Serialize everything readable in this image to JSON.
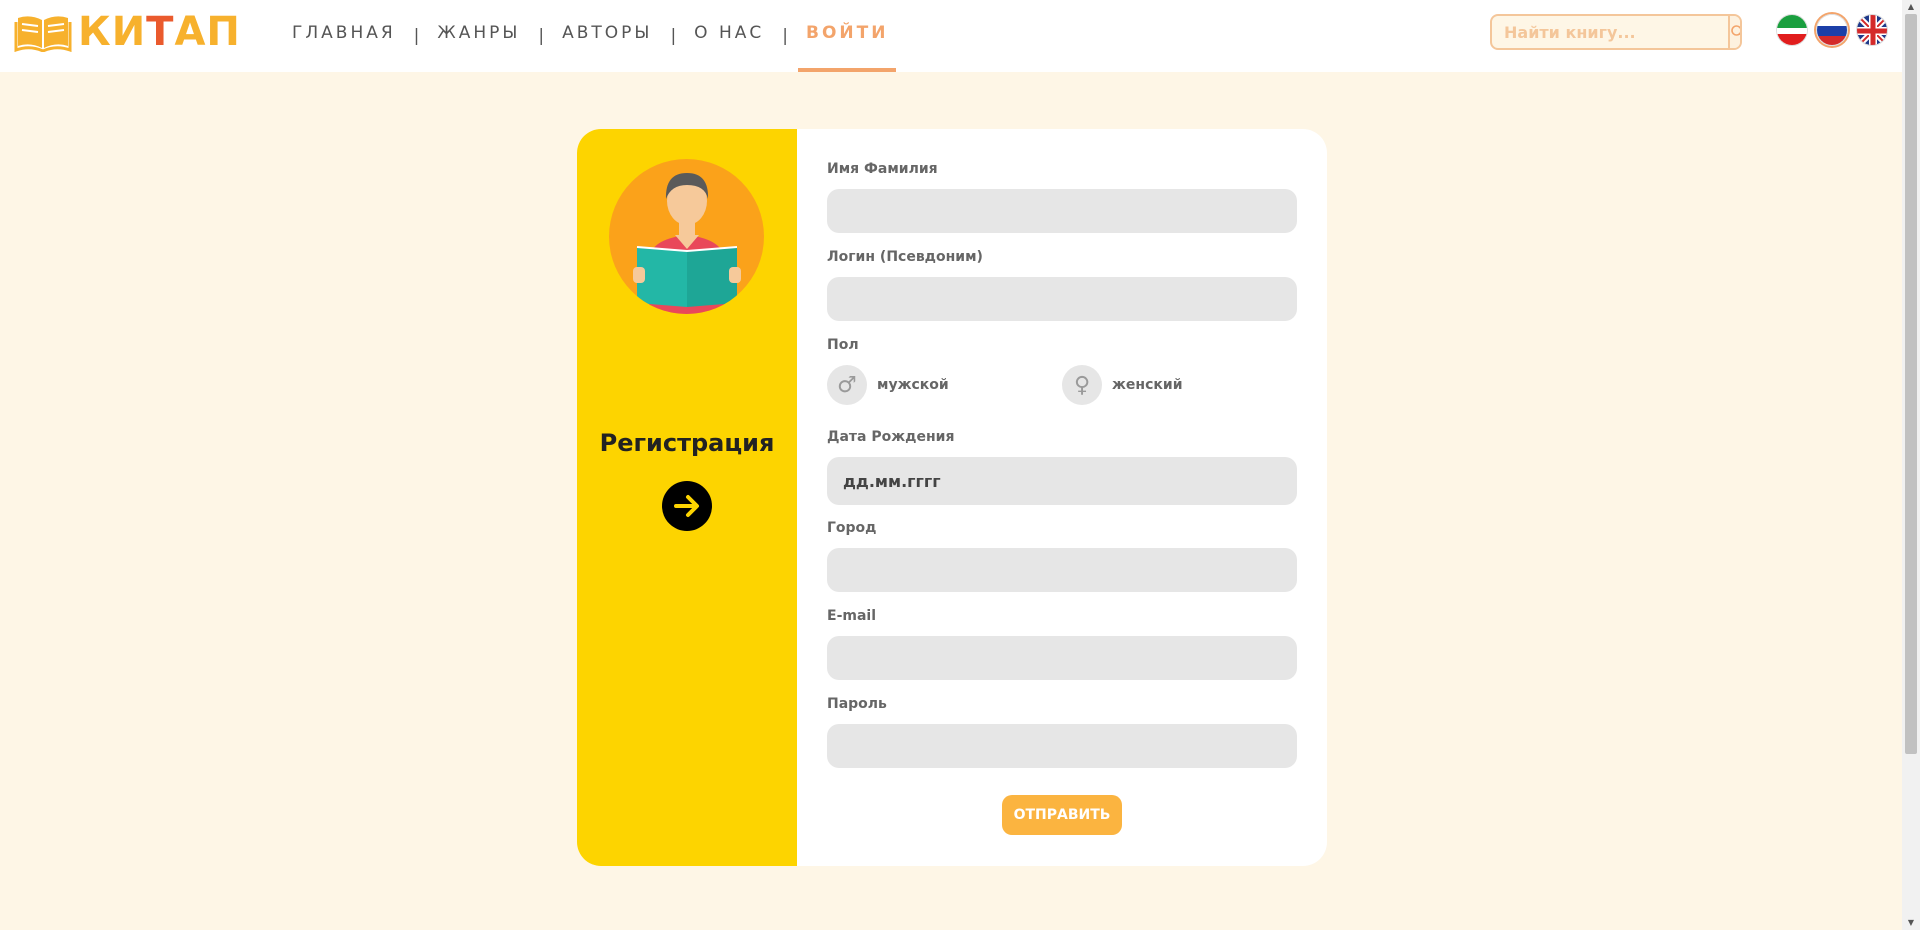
{
  "brand": {
    "logo_text_part1": "КИ",
    "logo_text_part2": "Т",
    "logo_text_part3": "АП"
  },
  "nav": {
    "items": [
      {
        "label": "ГЛАВНАЯ"
      },
      {
        "label": "ЖАНРЫ"
      },
      {
        "label": "АВТОРЫ"
      },
      {
        "label": "О НАС"
      },
      {
        "label": "ВОЙТИ"
      }
    ],
    "separator": "|",
    "active_index": 4
  },
  "search": {
    "placeholder": "Найти книгу...",
    "icon": "search-icon"
  },
  "languages": [
    {
      "name": "tatar-flag-icon",
      "code": "tt"
    },
    {
      "name": "russian-flag-icon",
      "code": "ru",
      "active": true
    },
    {
      "name": "uk-flag-icon",
      "code": "en"
    }
  ],
  "sidebar": {
    "title": "Регистрация",
    "arrow_icon": "arrow-right-icon",
    "avatar_icon": "reader-avatar-icon"
  },
  "form": {
    "full_name_label": "Имя Фамилия",
    "login_label": "Логин (Псевдоним)",
    "gender_label": "Пол",
    "gender_male": "мужской",
    "gender_female": "женский",
    "male_symbol": "♂",
    "female_symbol": "♀",
    "birthdate_label": "Дата Рождения",
    "birthdate_placeholder": "дд.мм.гггг",
    "city_label": "Город",
    "email_label": "E-mail",
    "password_label": "Пароль",
    "submit_label": "ОТПРАВИТЬ"
  },
  "colors": {
    "accent": "#f3a46b",
    "sidebar": "#fdd400",
    "avatar_bg": "#fba21a",
    "button": "#fbb440",
    "page_bg": "#fef6e6",
    "input_bg": "#e6e6e6"
  }
}
